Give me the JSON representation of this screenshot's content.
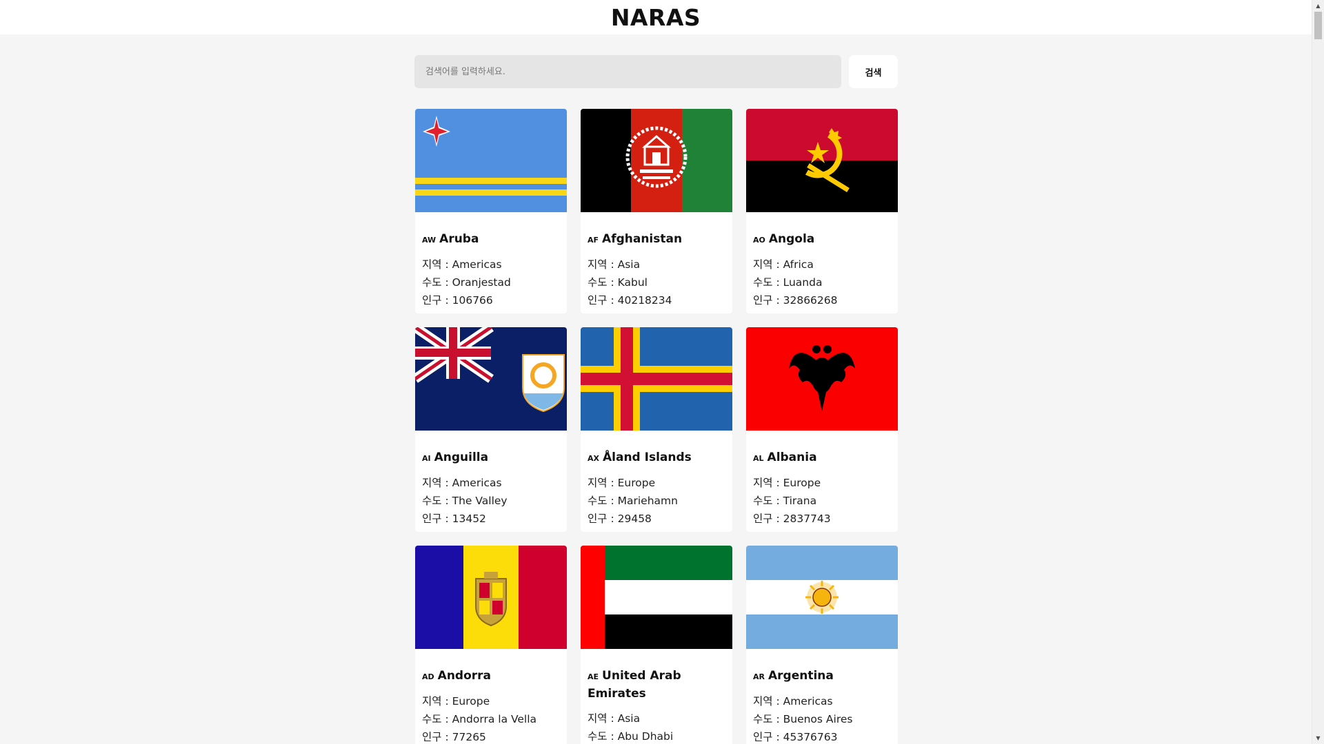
{
  "app": {
    "title": "NARAS"
  },
  "search": {
    "placeholder": "검색어를 입력하세요.",
    "button_label": "검색"
  },
  "labels": {
    "region": "지역 : ",
    "capital": "수도 : ",
    "population": "인구 : "
  },
  "countries": [
    {
      "code": "AW",
      "name": "Aruba",
      "region": "Americas",
      "capital": "Oranjestad",
      "population": "106766",
      "flag_icon": "aruba-flag"
    },
    {
      "code": "AF",
      "name": "Afghanistan",
      "region": "Asia",
      "capital": "Kabul",
      "population": "40218234",
      "flag_icon": "afghanistan-flag"
    },
    {
      "code": "AO",
      "name": "Angola",
      "region": "Africa",
      "capital": "Luanda",
      "population": "32866268",
      "flag_icon": "angola-flag"
    },
    {
      "code": "AI",
      "name": "Anguilla",
      "region": "Americas",
      "capital": "The Valley",
      "population": "13452",
      "flag_icon": "anguilla-flag"
    },
    {
      "code": "AX",
      "name": "Åland Islands",
      "region": "Europe",
      "capital": "Mariehamn",
      "population": "29458",
      "flag_icon": "aland-flag"
    },
    {
      "code": "AL",
      "name": "Albania",
      "region": "Europe",
      "capital": "Tirana",
      "population": "2837743",
      "flag_icon": "albania-flag"
    },
    {
      "code": "AD",
      "name": "Andorra",
      "region": "Europe",
      "capital": "Andorra la Vella",
      "population": "77265",
      "flag_icon": "andorra-flag"
    },
    {
      "code": "AE",
      "name": "United Arab Emirates",
      "region": "Asia",
      "capital": "Abu Dhabi",
      "population": "",
      "flag_icon": "uae-flag"
    },
    {
      "code": "AR",
      "name": "Argentina",
      "region": "Americas",
      "capital": "Buenos Aires",
      "population": "45376763",
      "flag_icon": "argentina-flag"
    }
  ],
  "colors": {
    "page_bg": "#f5f5f5",
    "header_bg": "#ffffff",
    "search_bg": "#e5e5e5",
    "card_bg": "#ffffff"
  }
}
